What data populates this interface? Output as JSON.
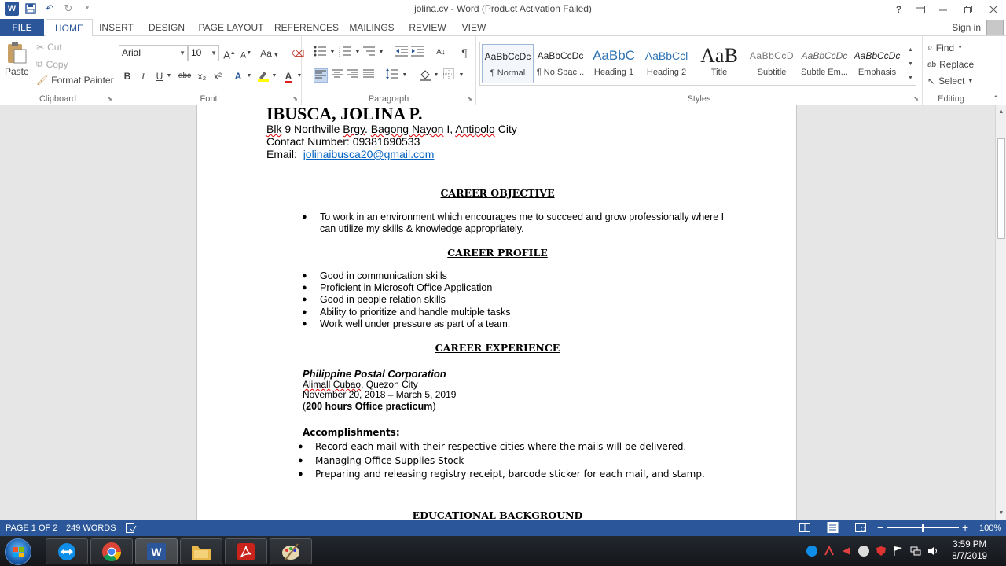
{
  "titlebar": {
    "title": "jolina.cv - Word (Product Activation Failed)",
    "help": "?",
    "qat_undo": "↶",
    "qat_redo": "↻",
    "qat_more": "⯆"
  },
  "tabs": {
    "file": "FILE",
    "home": "HOME",
    "insert": "INSERT",
    "design": "DESIGN",
    "page_layout": "PAGE LAYOUT",
    "references": "REFERENCES",
    "mailings": "MAILINGS",
    "review": "REVIEW",
    "view": "VIEW",
    "sign_in": "Sign in"
  },
  "ribbon": {
    "clipboard": {
      "label": "Clipboard",
      "paste": "Paste",
      "cut": "Cut",
      "copy": "Copy",
      "format_painter": "Format Painter"
    },
    "font": {
      "label": "Font",
      "font_name": "Arial",
      "font_size": "10",
      "bold": "B",
      "italic": "I",
      "underline": "U",
      "strike": "abc",
      "subscript": "x₂",
      "superscript": "x²",
      "grow": "A",
      "shrink": "A",
      "change_case": "Aa"
    },
    "paragraph": {
      "label": "Paragraph"
    },
    "styles": {
      "label": "Styles",
      "items": [
        {
          "preview": "AaBbCcDc",
          "name": "¶ Normal"
        },
        {
          "preview": "AaBbCcDc",
          "name": "¶ No Spac..."
        },
        {
          "preview": "AaBbC",
          "name": "Heading 1"
        },
        {
          "preview": "AaBbCcl",
          "name": "Heading 2"
        },
        {
          "preview": "AaB",
          "name": "Title"
        },
        {
          "preview": "AaBbCcD",
          "name": "Subtitle"
        },
        {
          "preview": "AaBbCcDc",
          "name": "Subtle Em..."
        },
        {
          "preview": "AaBbCcDc",
          "name": "Emphasis"
        }
      ]
    },
    "editing": {
      "label": "Editing",
      "find": "Find",
      "replace": "Replace",
      "select": "Select"
    }
  },
  "document": {
    "name": "IBUSCA, JOLINA P.",
    "address_parts": [
      "Blk",
      " 9 Northville ",
      "Brgy",
      ". ",
      "Bagong Nayon",
      " I, ",
      "Antipolo",
      " City"
    ],
    "contact": "Contact Number: 09381690533",
    "email_label": "Email:",
    "email": "jolinaibusca20@gmail.com",
    "career_objective_title": "CAREER OBJECTIVE",
    "career_objective_lines": [
      "To work in an environment which encourages me to succeed and grow professionally where I",
      "can utilize my skills & knowledge appropriately."
    ],
    "career_profile_title": "CAREER PROFILE",
    "career_profile": [
      "Good in communication skills",
      "Proficient in Microsoft Office Application",
      "Good in people relation skills",
      "Ability to prioritize and handle multiple tasks",
      "Work well under pressure as part of a team."
    ],
    "career_experience_title": "CAREER EXPERIENCE",
    "company": "Philippine Postal Corporation",
    "company_location_parts": [
      "Alimall",
      " ",
      "Cubao",
      ", Quezon City"
    ],
    "company_dates": "November 20, 2018 – March 5, 2019",
    "hours_open": "(",
    "hours": "200 hours Office practicum",
    "hours_close": ")",
    "accomplishments_title": "Accomplishments:",
    "accomplishments": [
      "Record each mail with their respective cities where the mails will be delivered.",
      "Managing Office Supplies Stock",
      "Preparing and releasing registry receipt, barcode sticker for each mail, and stamp."
    ],
    "education_title": "EDUCATIONAL BACKGROUND"
  },
  "statusbar": {
    "page": "PAGE 1 OF 2",
    "words": "249 WORDS",
    "zoom": "100%",
    "zoom_fraction": 0.5,
    "minus": "−",
    "plus": "+"
  },
  "taskbar": {
    "time": "3:59 PM",
    "date": "8/7/2019",
    "word_app": "W"
  },
  "colors": {
    "accent": "#2b579a",
    "link": "#0563c1"
  }
}
